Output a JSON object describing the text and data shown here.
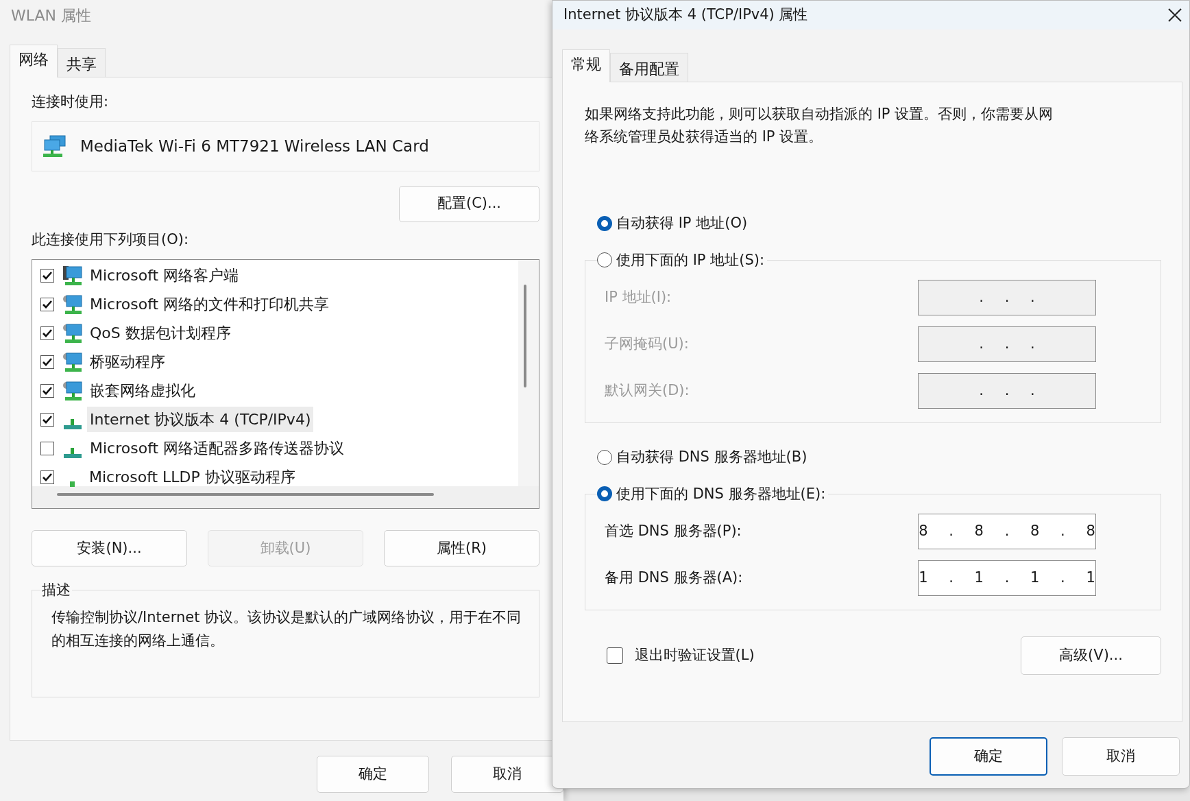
{
  "left_window": {
    "title": "WLAN 属性",
    "tabs": [
      {
        "label": "网络",
        "selected": true
      },
      {
        "label": "共享",
        "selected": false
      }
    ],
    "connect_using_label": "连接时使用:",
    "adapter": "MediaTek Wi-Fi 6 MT7921 Wireless LAN Card",
    "configure_button": "配置(C)...",
    "items_label": "此连接使用下列项目(O):",
    "items": [
      {
        "label": "Microsoft 网络客户端",
        "checked": true,
        "selected": false,
        "kind": "client"
      },
      {
        "label": "Microsoft 网络的文件和打印机共享",
        "checked": true,
        "selected": false,
        "kind": "service"
      },
      {
        "label": "QoS 数据包计划程序",
        "checked": true,
        "selected": false,
        "kind": "service"
      },
      {
        "label": "桥驱动程序",
        "checked": true,
        "selected": false,
        "kind": "service"
      },
      {
        "label": "嵌套网络虚拟化",
        "checked": true,
        "selected": false,
        "kind": "service"
      },
      {
        "label": "Internet 协议版本 4 (TCP/IPv4)",
        "checked": true,
        "selected": true,
        "kind": "protocol"
      },
      {
        "label": "Microsoft 网络适配器多路传送器协议",
        "checked": false,
        "selected": false,
        "kind": "protocol"
      },
      {
        "label": "Microsoft LLDP 协议驱动程序",
        "checked": true,
        "selected": false,
        "kind": "small-protocol"
      }
    ],
    "buttons": [
      {
        "label": "安装(N)...",
        "disabled": false
      },
      {
        "label": "卸载(U)",
        "disabled": true
      },
      {
        "label": "属性(R)",
        "disabled": false
      }
    ],
    "description": {
      "title": "描述",
      "text": "传输控制协议/Internet 协议。该协议是默认的广域网络协议，用于在不同的相互连接的网络上通信。"
    },
    "footer_buttons": [
      {
        "label": "确定"
      },
      {
        "label": "取消"
      }
    ]
  },
  "right_window": {
    "title": "Internet 协议版本 4 (TCP/IPv4) 属性",
    "tabs": [
      {
        "label": "常规",
        "selected": true
      },
      {
        "label": "备用配置",
        "selected": false
      }
    ],
    "intro": "如果网络支持此功能，则可以获取自动指派的 IP 设置。否则，你需要从网络系统管理员处获得适当的 IP 设置。",
    "ip_options": [
      {
        "label": "自动获得 IP 地址(O)",
        "selected": true
      },
      {
        "label": "使用下面的 IP 地址(S):",
        "selected": false
      }
    ],
    "ip_fields": [
      {
        "label": "IP 地址(I):",
        "value": ". . .",
        "disabled": true
      },
      {
        "label": "子网掩码(U):",
        "value": ". . .",
        "disabled": true
      },
      {
        "label": "默认网关(D):",
        "value": ". . .",
        "disabled": true
      }
    ],
    "dns_options": [
      {
        "label": "自动获得 DNS 服务器地址(B)",
        "selected": false
      },
      {
        "label": "使用下面的 DNS 服务器地址(E):",
        "selected": true
      }
    ],
    "dns_fields": [
      {
        "label": "首选 DNS 服务器(P):",
        "value": "8 . 8 . 8 . 8",
        "disabled": false
      },
      {
        "label": "备用 DNS 服务器(A):",
        "value": "1 . 1 . 1 . 1",
        "disabled": false
      }
    ],
    "validate_checkbox": {
      "label": "退出时验证设置(L)",
      "checked": false
    },
    "advanced_button": "高级(V)...",
    "footer_buttons": [
      {
        "label": "确定",
        "default": true
      },
      {
        "label": "取消",
        "default": false
      }
    ]
  }
}
